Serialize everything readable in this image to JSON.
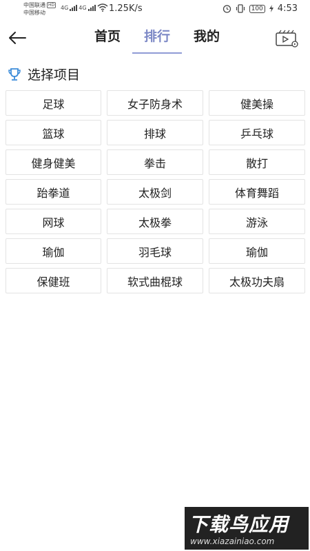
{
  "status_bar": {
    "carrier_1": "中国联通",
    "carrier_1_badge": "HD",
    "carrier_2": "中国移动",
    "network_1": "4G",
    "network_2": "4G",
    "net_speed": "1.25K/s",
    "battery": "100",
    "time": "4:53"
  },
  "nav": {
    "tabs": [
      {
        "label": "首页"
      },
      {
        "label": "排行"
      },
      {
        "label": "我的"
      }
    ],
    "active_tab": "排行",
    "accent_color": "#7d89c6"
  },
  "section": {
    "title": "选择项目",
    "icon": "trophy-icon"
  },
  "sports": [
    "足球",
    "女子防身术",
    "健美操",
    "篮球",
    "排球",
    "乒乓球",
    "健身健美",
    "拳击",
    "散打",
    "跆拳道",
    "太极剑",
    "体育舞蹈",
    "网球",
    "太极拳",
    "游泳",
    "瑜伽",
    "羽毛球",
    "瑜伽",
    "保健班",
    "软式曲棍球",
    "太极功夫扇"
  ],
  "watermark": {
    "title": "下载鸟应用",
    "url": "www.xiazainiao.com"
  }
}
